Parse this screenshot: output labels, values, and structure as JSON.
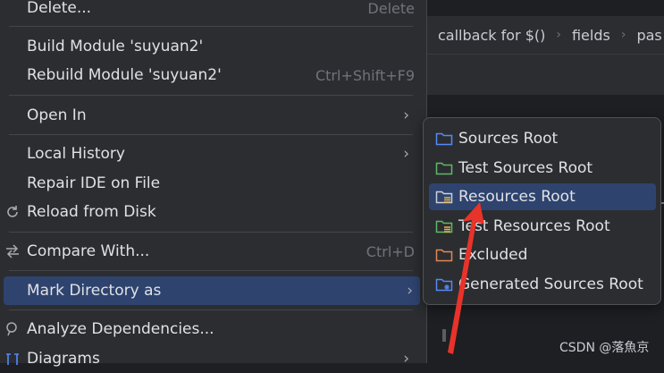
{
  "breadcrumb": {
    "items": [
      "callback for $()",
      "fields",
      "pas"
    ]
  },
  "menu": {
    "items": [
      {
        "label": "Delete...",
        "shortcut": "Delete"
      },
      {
        "label": "Build Module 'suyuan2'",
        "shortcut": ""
      },
      {
        "label": "Rebuild Module 'suyuan2'",
        "shortcut": "Ctrl+Shift+F9"
      },
      {
        "label": "Open In",
        "shortcut": ""
      },
      {
        "label": "Local History",
        "shortcut": ""
      },
      {
        "label": "Repair IDE on File",
        "shortcut": ""
      },
      {
        "label": "Reload from Disk",
        "shortcut": ""
      },
      {
        "label": "Compare With...",
        "shortcut": "Ctrl+D"
      },
      {
        "label": "Mark Directory as",
        "shortcut": ""
      },
      {
        "label": "Analyze Dependencies...",
        "shortcut": ""
      },
      {
        "label": "Diagrams",
        "shortcut": ""
      }
    ],
    "arrow_glyph": "›"
  },
  "submenu": {
    "items": [
      {
        "label": "Sources Root",
        "icon": "sources-root-icon",
        "color": "#548af7"
      },
      {
        "label": "Test Sources Root",
        "icon": "test-sources-root-icon",
        "color": "#5fb865"
      },
      {
        "label": "Resources Root",
        "icon": "resources-root-icon",
        "color": "#ced0d6"
      },
      {
        "label": "Test Resources Root",
        "icon": "test-resources-root-icon",
        "color": "#5fb865"
      },
      {
        "label": "Excluded",
        "icon": "excluded-icon",
        "color": "#e08855"
      },
      {
        "label": "Generated Sources Root",
        "icon": "generated-sources-root-icon",
        "color": "#548af7"
      }
    ]
  },
  "watermark": "CSDN @落魚京",
  "colors": {
    "selection": "#2e436e",
    "menu_bg": "#2b2d30",
    "annotation_arrow": "#e8332a"
  }
}
